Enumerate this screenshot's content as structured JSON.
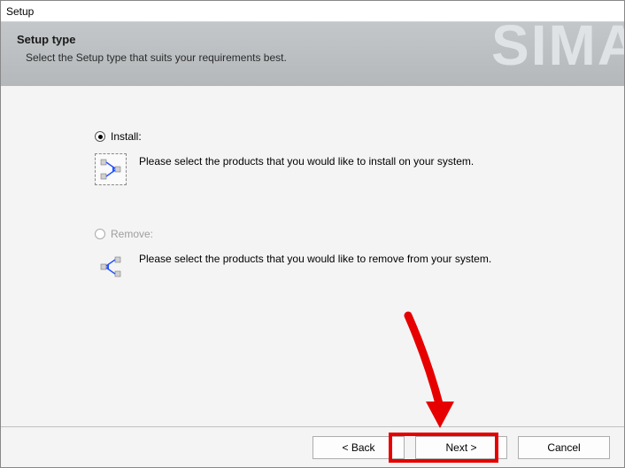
{
  "window": {
    "title": "Setup"
  },
  "header": {
    "title": "Setup type",
    "subtitle": "Select the Setup type that suits your requirements best.",
    "brand": "SIMA"
  },
  "options": {
    "install": {
      "label": "Install:",
      "description": "Please select the products that you would like to install on your system."
    },
    "remove": {
      "label": "Remove:",
      "description": "Please select the products that you would like to remove from your system."
    }
  },
  "buttons": {
    "back": "< Back",
    "next": "Next >",
    "cancel": "Cancel"
  }
}
